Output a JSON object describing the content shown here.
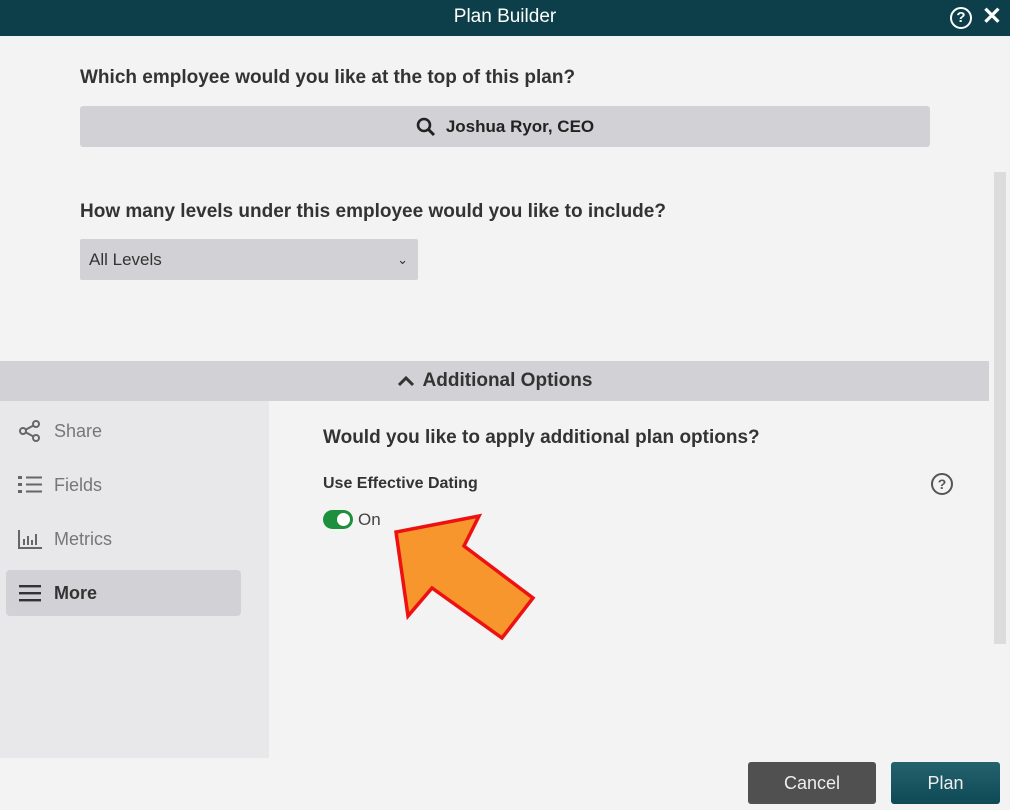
{
  "header": {
    "title": "Plan Builder",
    "help_icon": "question-circle-icon",
    "close_icon": "close-icon",
    "close_glyph": "✕",
    "help_glyph": "?"
  },
  "top_question": "Which employee would you like at the top of this plan?",
  "employee_search": {
    "value": "Joshua Ryor, CEO",
    "icon": "search-icon"
  },
  "levels_question": "How many levels under this employee would you like to include?",
  "levels_select": {
    "value": "All Levels"
  },
  "additional_options": {
    "label": "Additional Options"
  },
  "sidebar": {
    "items": [
      {
        "label": "Share",
        "icon": "share-icon"
      },
      {
        "label": "Fields",
        "icon": "list-icon"
      },
      {
        "label": "Metrics",
        "icon": "bar-chart-icon"
      },
      {
        "label": "More",
        "icon": "menu-icon",
        "active": true
      }
    ]
  },
  "panel": {
    "question": "Would you like to apply additional plan options?",
    "effective_dating": {
      "label": "Use Effective Dating",
      "state": "On",
      "enabled": true,
      "help_glyph": "?"
    }
  },
  "footer": {
    "cancel": "Cancel",
    "plan": "Plan"
  },
  "colors": {
    "header": "#0c3f4a",
    "toggle_on": "#1e8f3d",
    "annotation_arrow": "#f7962d",
    "annotation_outline": "#ee1111"
  }
}
